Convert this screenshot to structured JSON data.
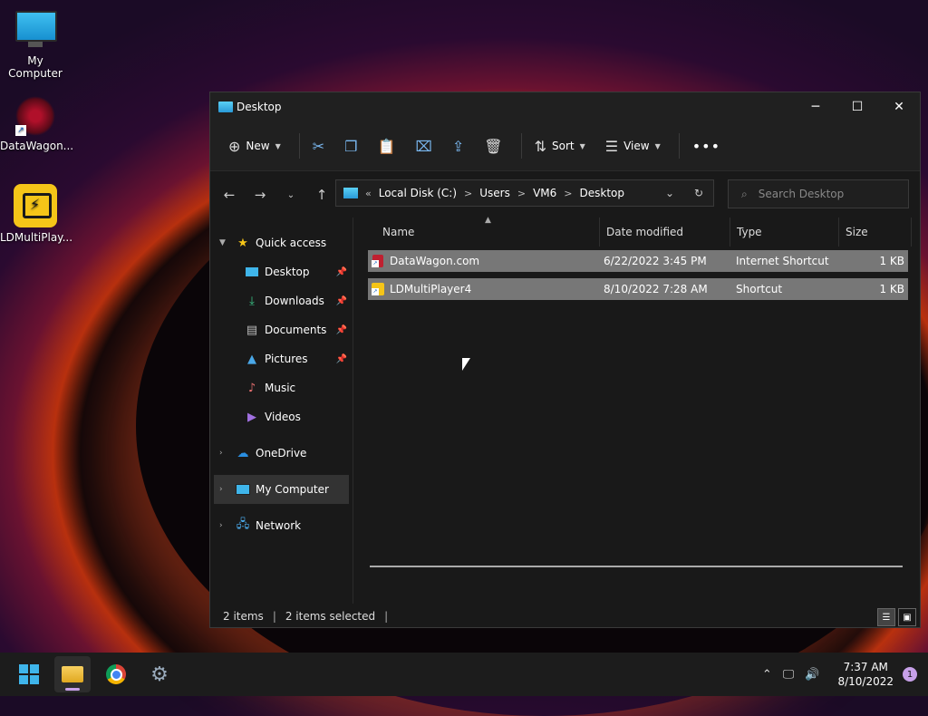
{
  "desktop": {
    "icons": [
      {
        "label": "My Computer"
      },
      {
        "label": "DataWagon..."
      },
      {
        "label": "LDMultiPlay..."
      }
    ]
  },
  "window": {
    "title": "Desktop",
    "toolbar": {
      "new_label": "New",
      "sort_label": "Sort",
      "view_label": "View"
    },
    "address": {
      "prefix": "«",
      "crumbs": [
        "Local Disk (C:)",
        "Users",
        "VM6",
        "Desktop"
      ]
    },
    "search": {
      "placeholder": "Search Desktop"
    },
    "sidebar": {
      "quick_access": "Quick access",
      "items": [
        {
          "label": "Desktop"
        },
        {
          "label": "Downloads"
        },
        {
          "label": "Documents"
        },
        {
          "label": "Pictures"
        },
        {
          "label": "Music"
        },
        {
          "label": "Videos"
        }
      ],
      "onedrive": "OneDrive",
      "my_computer": "My Computer",
      "network": "Network"
    },
    "columns": {
      "name": "Name",
      "date": "Date modified",
      "type": "Type",
      "size": "Size"
    },
    "files": [
      {
        "name": "DataWagon.com",
        "date": "6/22/2022 3:45 PM",
        "type": "Internet Shortcut",
        "size": "1 KB"
      },
      {
        "name": "LDMultiPlayer4",
        "date": "8/10/2022 7:28 AM",
        "type": "Shortcut",
        "size": "1 KB"
      }
    ],
    "status": {
      "count": "2 items",
      "selected": "2 items selected"
    }
  },
  "taskbar": {
    "time": "7:37 AM",
    "date": "8/10/2022",
    "notifications": "1"
  },
  "colors": {
    "accent": "#7ab8f0",
    "selection": "#777777",
    "taskbar": "#1c1c1c"
  }
}
